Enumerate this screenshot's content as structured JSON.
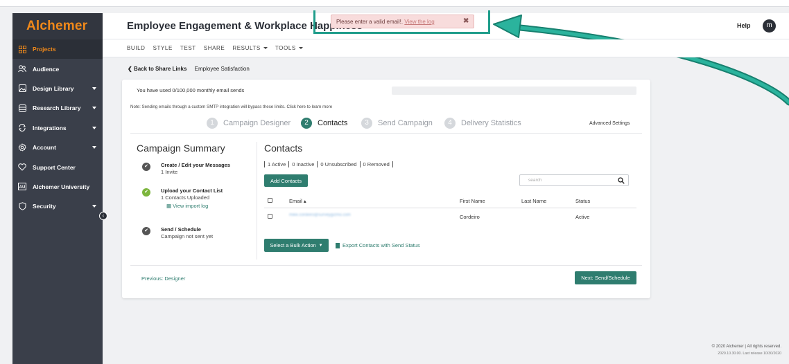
{
  "app": {
    "logo": "Alchemer"
  },
  "sidebar": {
    "items": [
      {
        "label": "Projects",
        "icon": "grid-icon",
        "active": true
      },
      {
        "label": "Audience",
        "icon": "users-icon"
      },
      {
        "label": "Design Library",
        "icon": "image-icon",
        "caret": true
      },
      {
        "label": "Research Library",
        "icon": "database-icon",
        "caret": true
      },
      {
        "label": "Integrations",
        "icon": "sync-icon",
        "caret": true
      },
      {
        "label": "Account",
        "icon": "gear-icon",
        "caret": true
      },
      {
        "label": "Support Center",
        "icon": "heart-icon"
      },
      {
        "label": "Alchemer University",
        "icon": "au-icon",
        "badge": "AU"
      },
      {
        "label": "Security",
        "icon": "shield-icon",
        "caret": true
      }
    ]
  },
  "header": {
    "title": "Employee Engagement & Workplace Happiness",
    "help": "Help",
    "avatar": "m"
  },
  "toast": {
    "message": "Please enter a valid email!.",
    "link": "View the log",
    "close": "✖"
  },
  "menubar": {
    "items": [
      {
        "label": "BUILD"
      },
      {
        "label": "STYLE"
      },
      {
        "label": "TEST"
      },
      {
        "label": "SHARE"
      },
      {
        "label": "RESULTS",
        "dropdown": true
      },
      {
        "label": "TOOLS",
        "dropdown": true
      }
    ]
  },
  "breadcrumb": {
    "back": "Back to Share Links",
    "current": "Employee Satisfaction"
  },
  "usage": {
    "text": "You have used 0/100,000 monthly email sends",
    "fraction": 0,
    "note": "Note: Sending emails through a custom SMTP integration will bypass these limits. Click here to learn more"
  },
  "steps": [
    {
      "num": "1",
      "label": "Campaign Designer"
    },
    {
      "num": "2",
      "label": "Contacts",
      "current": true
    },
    {
      "num": "3",
      "label": "Send Campaign"
    },
    {
      "num": "4",
      "label": "Delivery Statistics"
    }
  ],
  "advanced_settings": "Advanced Settings",
  "summary": {
    "title": "Campaign Summary",
    "items": [
      {
        "head": "Create / Edit your Messages",
        "sub": "1 Invite"
      },
      {
        "head": "Upload your Contact List",
        "sub": "1 Contacts Uploaded",
        "link": "View import log"
      },
      {
        "head": "Send / Schedule",
        "sub": "Campaign not sent yet"
      }
    ]
  },
  "contacts": {
    "title": "Contacts",
    "filters": [
      "1 Active",
      "0 Inactive",
      "0 Unsubscribed",
      "0 Removed"
    ],
    "add_button": "Add Contacts",
    "search_placeholder": "search",
    "columns": {
      "email": "Email ▴",
      "first_name": "First Name",
      "last_name": "Last Name",
      "status": "Status"
    },
    "rows": [
      {
        "email": "mike.cordeiro@surveygizmo.com",
        "first_name": "Cordeiro",
        "last_name": "",
        "status": "Active"
      }
    ],
    "bulk_button": "Select a Bulk Action",
    "export_link": "Export Contacts with Send Status"
  },
  "footer_nav": {
    "previous": "Previous: Designer",
    "next": "Next: Send/Schedule"
  },
  "footer": {
    "copyright": "© 2020 Alchemer | All rights reserved.",
    "release": "2020.10.30.00. Last release 10/30/2020"
  }
}
